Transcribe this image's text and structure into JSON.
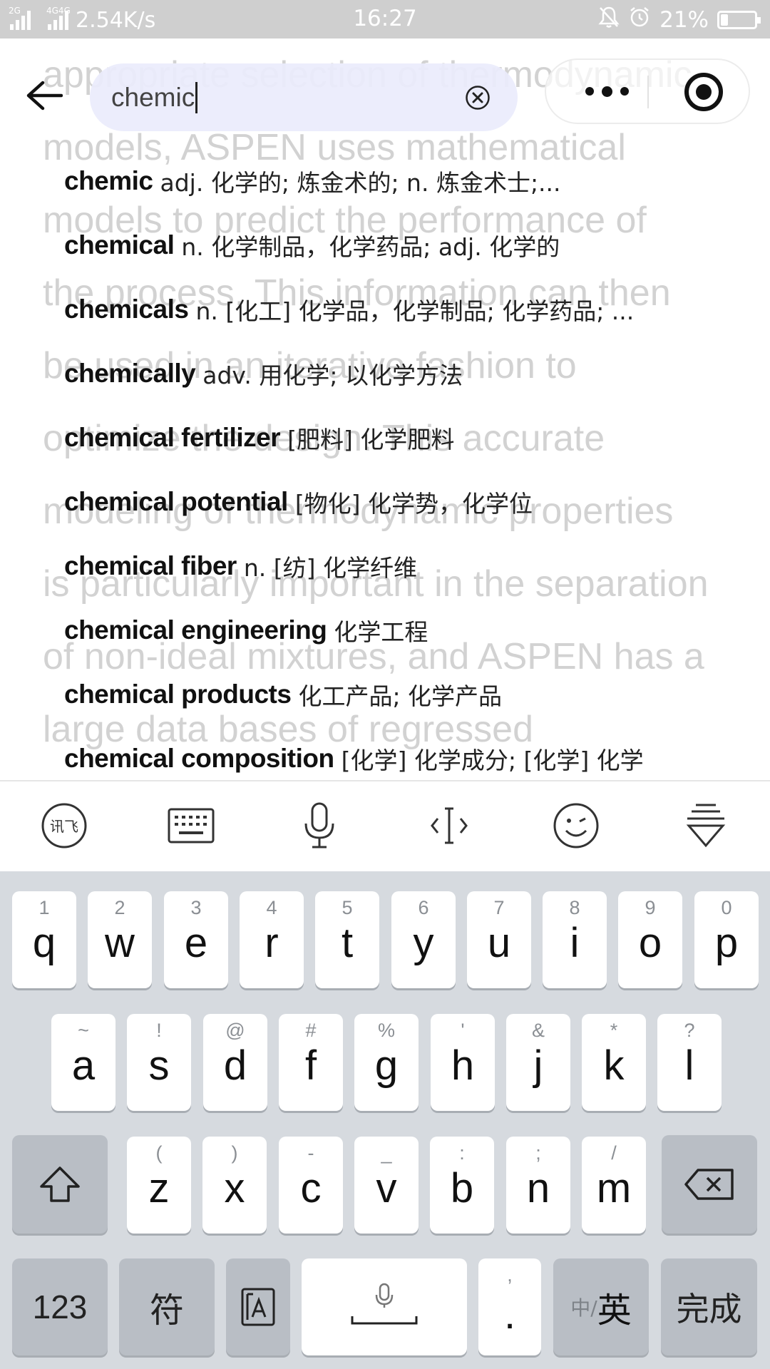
{
  "status_bar": {
    "signal1_label": "2G",
    "signal2_label": "4G4G",
    "net_speed": "2.54K/s",
    "time": "16:27",
    "battery": "21%",
    "battery_level": 0.21
  },
  "background_text": [
    "appropriate selection of thermodynamic",
    "models, ASPEN uses mathematical",
    "models to predict the performance of",
    "the process. This information can then",
    "be used in an iterative fashion to",
    "optimize the design. This accurate",
    "modeling of thermodynamic properties",
    "is particularly important in the separation",
    "of non-ideal mixtures, and ASPEN has a",
    "large data bases of regressed"
  ],
  "header": {
    "search_value": "chemic",
    "icons": [
      "back-arrow-icon",
      "clear-circle-x-icon",
      "more-dots-icon",
      "target-circle-icon"
    ]
  },
  "suggestions": [
    {
      "word": "chemic",
      "def": "adj. 化学的; 炼金术的; n. 炼金术士;..."
    },
    {
      "word": "chemical",
      "def": "n. 化学制品，化学药品; adj. 化学的"
    },
    {
      "word": "chemicals",
      "def": "n. [化工] 化学品，化学制品; 化学药品; ..."
    },
    {
      "word": "chemically",
      "def": "adv. 用化学; 以化学方法"
    },
    {
      "word": "chemical fertilizer",
      "def": "[肥料] 化学肥料"
    },
    {
      "word": "chemical potential",
      "def": "[物化] 化学势，化学位"
    },
    {
      "word": "chemical fiber",
      "def": "n. [纺] 化学纤维"
    },
    {
      "word": "chemical engineering",
      "def": "化学工程"
    },
    {
      "word": "chemical products",
      "def": "化工产品; 化学产品"
    },
    {
      "word": "chemical composition",
      "def": "[化学] 化学成分; [化学] 化学"
    }
  ],
  "keyboard": {
    "toolbar_icons": [
      "xunfei-logo-icon",
      "keyboard-icon",
      "microphone-icon",
      "cursor-move-icon",
      "emoji-icon",
      "hide-keyboard-icon"
    ],
    "row1": [
      {
        "main": "q",
        "sub": "1"
      },
      {
        "main": "w",
        "sub": "2"
      },
      {
        "main": "e",
        "sub": "3"
      },
      {
        "main": "r",
        "sub": "4"
      },
      {
        "main": "t",
        "sub": "5"
      },
      {
        "main": "y",
        "sub": "6"
      },
      {
        "main": "u",
        "sub": "7"
      },
      {
        "main": "i",
        "sub": "8"
      },
      {
        "main": "o",
        "sub": "9"
      },
      {
        "main": "p",
        "sub": "0"
      }
    ],
    "row2": [
      {
        "main": "a",
        "sub": "~"
      },
      {
        "main": "s",
        "sub": "!"
      },
      {
        "main": "d",
        "sub": "@"
      },
      {
        "main": "f",
        "sub": "#"
      },
      {
        "main": "g",
        "sub": "%"
      },
      {
        "main": "h",
        "sub": "'"
      },
      {
        "main": "j",
        "sub": "&"
      },
      {
        "main": "k",
        "sub": "*"
      },
      {
        "main": "l",
        "sub": "?"
      }
    ],
    "row3": [
      {
        "main": "z",
        "sub": "("
      },
      {
        "main": "x",
        "sub": ")"
      },
      {
        "main": "c",
        "sub": "-"
      },
      {
        "main": "v",
        "sub": "_"
      },
      {
        "main": "b",
        "sub": ":"
      },
      {
        "main": "n",
        "sub": ";"
      },
      {
        "main": "m",
        "sub": "/"
      }
    ],
    "key_123": "123",
    "key_symbols": "符",
    "key_period": ".",
    "key_period_sub": ",",
    "key_lang_small": "中/",
    "key_lang_big": "英",
    "key_done": "完成"
  }
}
